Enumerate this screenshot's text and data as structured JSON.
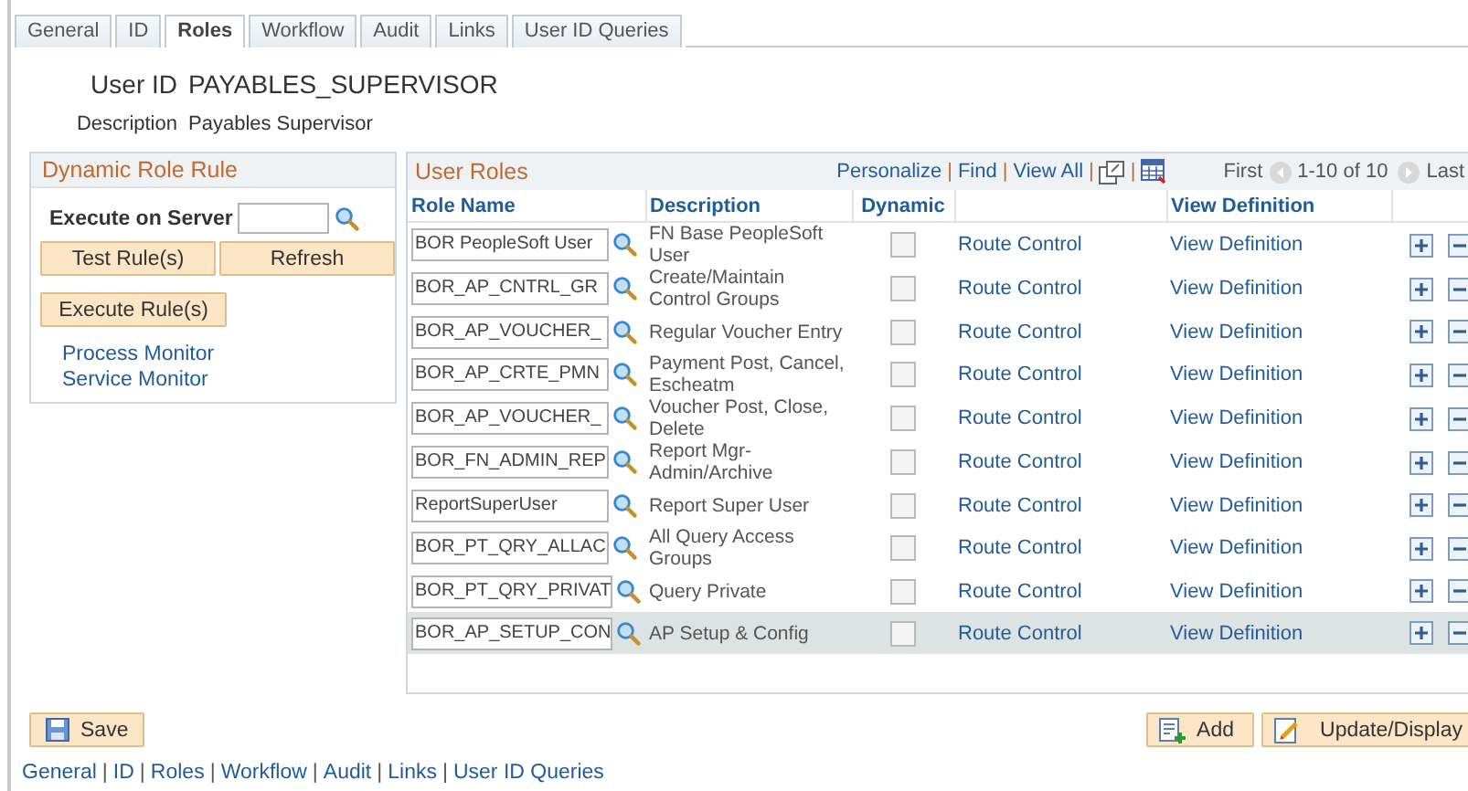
{
  "tabs": [
    {
      "label": "General",
      "selected": false
    },
    {
      "label": "ID",
      "selected": false
    },
    {
      "label": "Roles",
      "selected": true
    },
    {
      "label": "Workflow",
      "selected": false
    },
    {
      "label": "Audit",
      "selected": false
    },
    {
      "label": "Links",
      "selected": false
    },
    {
      "label": "User ID Queries",
      "selected": false
    }
  ],
  "user_id": {
    "label": "User ID",
    "value": "PAYABLES_SUPERVISOR"
  },
  "description": {
    "label": "Description",
    "value": "Payables Supervisor"
  },
  "dynamic_role_rule": {
    "title": "Dynamic Role Rule",
    "server_label": "Execute on Server",
    "buttons": [
      "Test Rule(s)",
      "Refresh"
    ],
    "execute_button": "Execute Rule(s)",
    "links": [
      "Process Monitor",
      "Service Monitor"
    ]
  },
  "user_roles": {
    "title": "User Roles",
    "separator": "|",
    "toolbar_links": [
      "Personalize",
      "Find",
      "View All"
    ],
    "first": "First",
    "range": "1-10 of 10",
    "last": "Last",
    "columns": [
      "Role Name",
      "Description",
      "Dynamic",
      "",
      "View Definition"
    ],
    "rows": [
      {
        "role": "BOR PeopleSoft User",
        "description": "FN Base PeopleSoft User",
        "dynamic": false,
        "route": "Route Control",
        "view": "View Definition",
        "selected": false
      },
      {
        "role": "BOR_AP_CNTRL_GR",
        "description": "Create/Maintain Control Groups",
        "dynamic": false,
        "route": "Route Control",
        "view": "View Definition",
        "selected": false
      },
      {
        "role": "BOR_AP_VOUCHER_",
        "description": "Regular Voucher Entry",
        "dynamic": false,
        "route": "Route Control",
        "view": "View Definition",
        "selected": false
      },
      {
        "role": "BOR_AP_CRTE_PMN",
        "description": "Payment Post, Cancel, Escheatm",
        "dynamic": false,
        "route": "Route Control",
        "view": "View Definition",
        "selected": false
      },
      {
        "role": "BOR_AP_VOUCHER_",
        "description": "Voucher Post, Close, Delete",
        "dynamic": false,
        "route": "Route Control",
        "view": "View Definition",
        "selected": false
      },
      {
        "role": "BOR_FN_ADMIN_REP",
        "description": "Report Mgr-Admin/Archive",
        "dynamic": false,
        "route": "Route Control",
        "view": "View Definition",
        "selected": false
      },
      {
        "role": "ReportSuperUser",
        "description": "Report Super User",
        "dynamic": false,
        "route": "Route Control",
        "view": "View Definition",
        "selected": false
      },
      {
        "role": "BOR_PT_QRY_ALLAC",
        "description": "All Query Access Groups",
        "dynamic": false,
        "route": "Route Control",
        "view": "View Definition",
        "selected": false
      },
      {
        "role": "BOR_PT_QRY_PRIVAT",
        "description": "Query Private",
        "dynamic": false,
        "route": "Route Control",
        "view": "View Definition",
        "selected": false
      },
      {
        "role": "BOR_AP_SETUP_CON",
        "description": "AP Setup & Config",
        "dynamic": false,
        "route": "Route Control",
        "view": "View Definition",
        "selected": true
      }
    ]
  },
  "save_button": "Save",
  "add_button": "Add",
  "update_button": "Update/Display",
  "footer_separator": "|",
  "footer_links": [
    "General",
    "ID",
    "Roles",
    "Workflow",
    "Audit",
    "Links",
    "User ID Queries"
  ]
}
